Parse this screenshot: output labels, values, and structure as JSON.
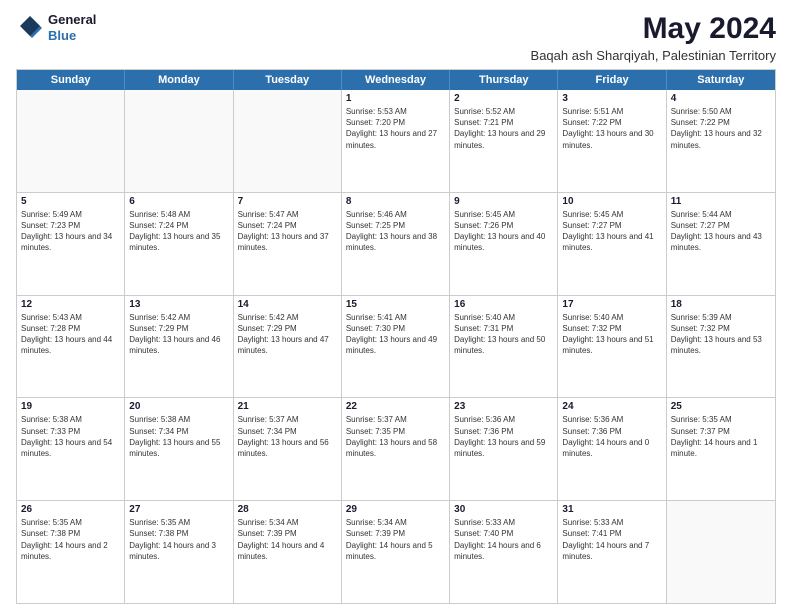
{
  "header": {
    "logo_line1": "General",
    "logo_line2": "Blue",
    "month_year": "May 2024",
    "location": "Baqah ash Sharqiyah, Palestinian Territory"
  },
  "day_headers": [
    "Sunday",
    "Monday",
    "Tuesday",
    "Wednesday",
    "Thursday",
    "Friday",
    "Saturday"
  ],
  "weeks": [
    [
      {
        "day": "",
        "info": ""
      },
      {
        "day": "",
        "info": ""
      },
      {
        "day": "",
        "info": ""
      },
      {
        "day": "1",
        "info": "Sunrise: 5:53 AM\nSunset: 7:20 PM\nDaylight: 13 hours and 27 minutes."
      },
      {
        "day": "2",
        "info": "Sunrise: 5:52 AM\nSunset: 7:21 PM\nDaylight: 13 hours and 29 minutes."
      },
      {
        "day": "3",
        "info": "Sunrise: 5:51 AM\nSunset: 7:22 PM\nDaylight: 13 hours and 30 minutes."
      },
      {
        "day": "4",
        "info": "Sunrise: 5:50 AM\nSunset: 7:22 PM\nDaylight: 13 hours and 32 minutes."
      }
    ],
    [
      {
        "day": "5",
        "info": "Sunrise: 5:49 AM\nSunset: 7:23 PM\nDaylight: 13 hours and 34 minutes."
      },
      {
        "day": "6",
        "info": "Sunrise: 5:48 AM\nSunset: 7:24 PM\nDaylight: 13 hours and 35 minutes."
      },
      {
        "day": "7",
        "info": "Sunrise: 5:47 AM\nSunset: 7:24 PM\nDaylight: 13 hours and 37 minutes."
      },
      {
        "day": "8",
        "info": "Sunrise: 5:46 AM\nSunset: 7:25 PM\nDaylight: 13 hours and 38 minutes."
      },
      {
        "day": "9",
        "info": "Sunrise: 5:45 AM\nSunset: 7:26 PM\nDaylight: 13 hours and 40 minutes."
      },
      {
        "day": "10",
        "info": "Sunrise: 5:45 AM\nSunset: 7:27 PM\nDaylight: 13 hours and 41 minutes."
      },
      {
        "day": "11",
        "info": "Sunrise: 5:44 AM\nSunset: 7:27 PM\nDaylight: 13 hours and 43 minutes."
      }
    ],
    [
      {
        "day": "12",
        "info": "Sunrise: 5:43 AM\nSunset: 7:28 PM\nDaylight: 13 hours and 44 minutes."
      },
      {
        "day": "13",
        "info": "Sunrise: 5:42 AM\nSunset: 7:29 PM\nDaylight: 13 hours and 46 minutes."
      },
      {
        "day": "14",
        "info": "Sunrise: 5:42 AM\nSunset: 7:29 PM\nDaylight: 13 hours and 47 minutes."
      },
      {
        "day": "15",
        "info": "Sunrise: 5:41 AM\nSunset: 7:30 PM\nDaylight: 13 hours and 49 minutes."
      },
      {
        "day": "16",
        "info": "Sunrise: 5:40 AM\nSunset: 7:31 PM\nDaylight: 13 hours and 50 minutes."
      },
      {
        "day": "17",
        "info": "Sunrise: 5:40 AM\nSunset: 7:32 PM\nDaylight: 13 hours and 51 minutes."
      },
      {
        "day": "18",
        "info": "Sunrise: 5:39 AM\nSunset: 7:32 PM\nDaylight: 13 hours and 53 minutes."
      }
    ],
    [
      {
        "day": "19",
        "info": "Sunrise: 5:38 AM\nSunset: 7:33 PM\nDaylight: 13 hours and 54 minutes."
      },
      {
        "day": "20",
        "info": "Sunrise: 5:38 AM\nSunset: 7:34 PM\nDaylight: 13 hours and 55 minutes."
      },
      {
        "day": "21",
        "info": "Sunrise: 5:37 AM\nSunset: 7:34 PM\nDaylight: 13 hours and 56 minutes."
      },
      {
        "day": "22",
        "info": "Sunrise: 5:37 AM\nSunset: 7:35 PM\nDaylight: 13 hours and 58 minutes."
      },
      {
        "day": "23",
        "info": "Sunrise: 5:36 AM\nSunset: 7:36 PM\nDaylight: 13 hours and 59 minutes."
      },
      {
        "day": "24",
        "info": "Sunrise: 5:36 AM\nSunset: 7:36 PM\nDaylight: 14 hours and 0 minutes."
      },
      {
        "day": "25",
        "info": "Sunrise: 5:35 AM\nSunset: 7:37 PM\nDaylight: 14 hours and 1 minute."
      }
    ],
    [
      {
        "day": "26",
        "info": "Sunrise: 5:35 AM\nSunset: 7:38 PM\nDaylight: 14 hours and 2 minutes."
      },
      {
        "day": "27",
        "info": "Sunrise: 5:35 AM\nSunset: 7:38 PM\nDaylight: 14 hours and 3 minutes."
      },
      {
        "day": "28",
        "info": "Sunrise: 5:34 AM\nSunset: 7:39 PM\nDaylight: 14 hours and 4 minutes."
      },
      {
        "day": "29",
        "info": "Sunrise: 5:34 AM\nSunset: 7:39 PM\nDaylight: 14 hours and 5 minutes."
      },
      {
        "day": "30",
        "info": "Sunrise: 5:33 AM\nSunset: 7:40 PM\nDaylight: 14 hours and 6 minutes."
      },
      {
        "day": "31",
        "info": "Sunrise: 5:33 AM\nSunset: 7:41 PM\nDaylight: 14 hours and 7 minutes."
      },
      {
        "day": "",
        "info": ""
      }
    ]
  ]
}
